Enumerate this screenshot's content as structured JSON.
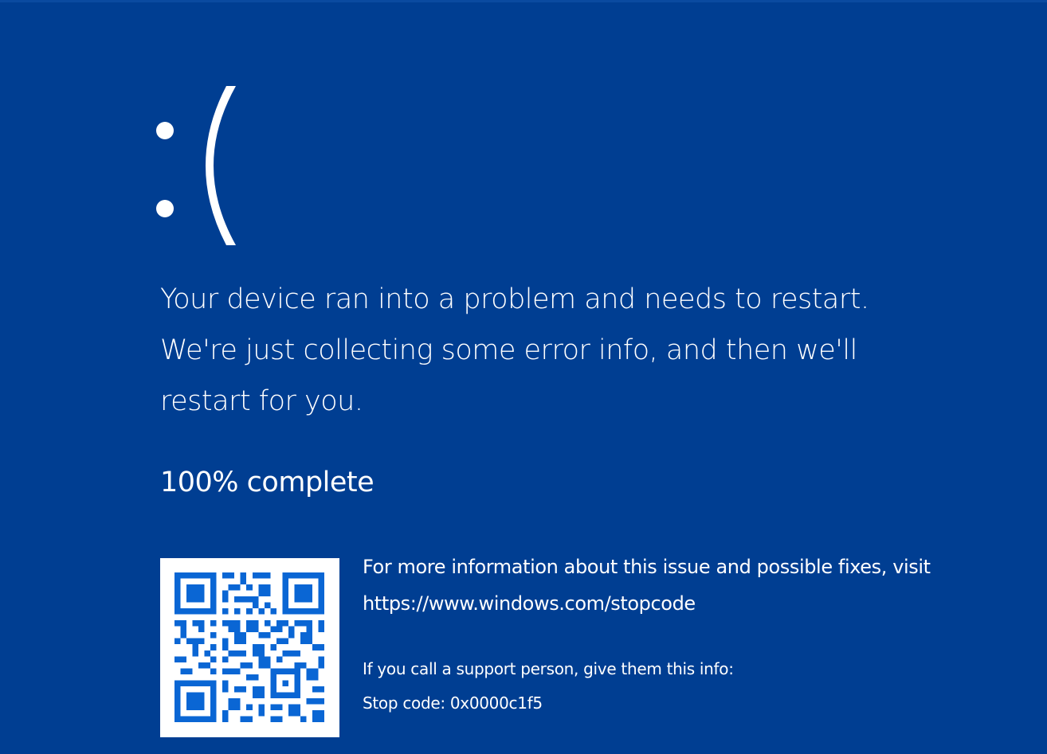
{
  "screen": {
    "background_color": "#003E92",
    "text_color": "#FFFFFF",
    "qr_color": "#0A66D4"
  },
  "face": {
    "icon": "sad-face-icon"
  },
  "message": {
    "line1": "Your device ran into a problem and needs to restart.",
    "line2": "We're just collecting some error info, and then we'll",
    "line3": "restart for you."
  },
  "progress": {
    "text": "100% complete",
    "percent": 100
  },
  "qr": {
    "icon": "qr-code-icon"
  },
  "info": {
    "more_info": "For more information about this issue and possible fixes, visit",
    "url": "https://www.windows.com/stopcode",
    "support": "If you call a support person, give them this info:",
    "stop_code": "Stop code: 0x0000c1f5"
  }
}
